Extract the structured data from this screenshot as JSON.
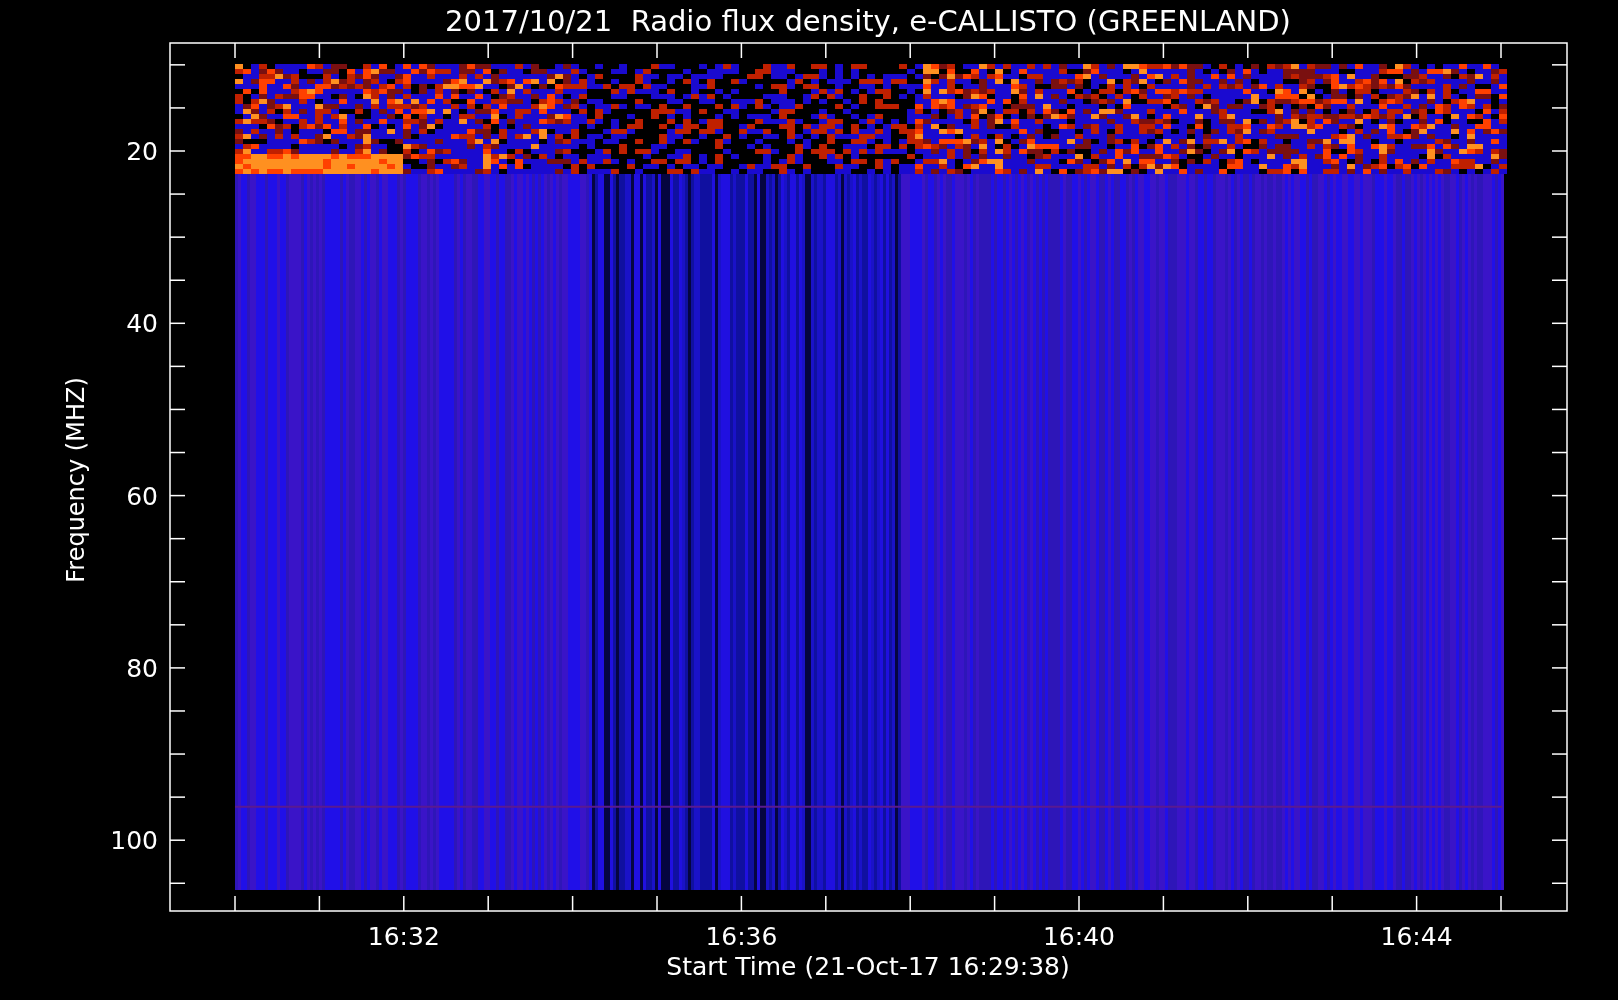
{
  "title": "2017/10/21  Radio flux density, e-CALLISTO (GREENLAND)",
  "ylabel": "Frequency (MHZ)",
  "xlabel": "Start Time (21-Oct-17 16:29:38)",
  "y_tick_labels": [
    "20",
    "40",
    "60",
    "80",
    "100"
  ],
  "x_tick_labels": [
    "16:32",
    "16:36",
    "16:40",
    "16:44"
  ]
}
